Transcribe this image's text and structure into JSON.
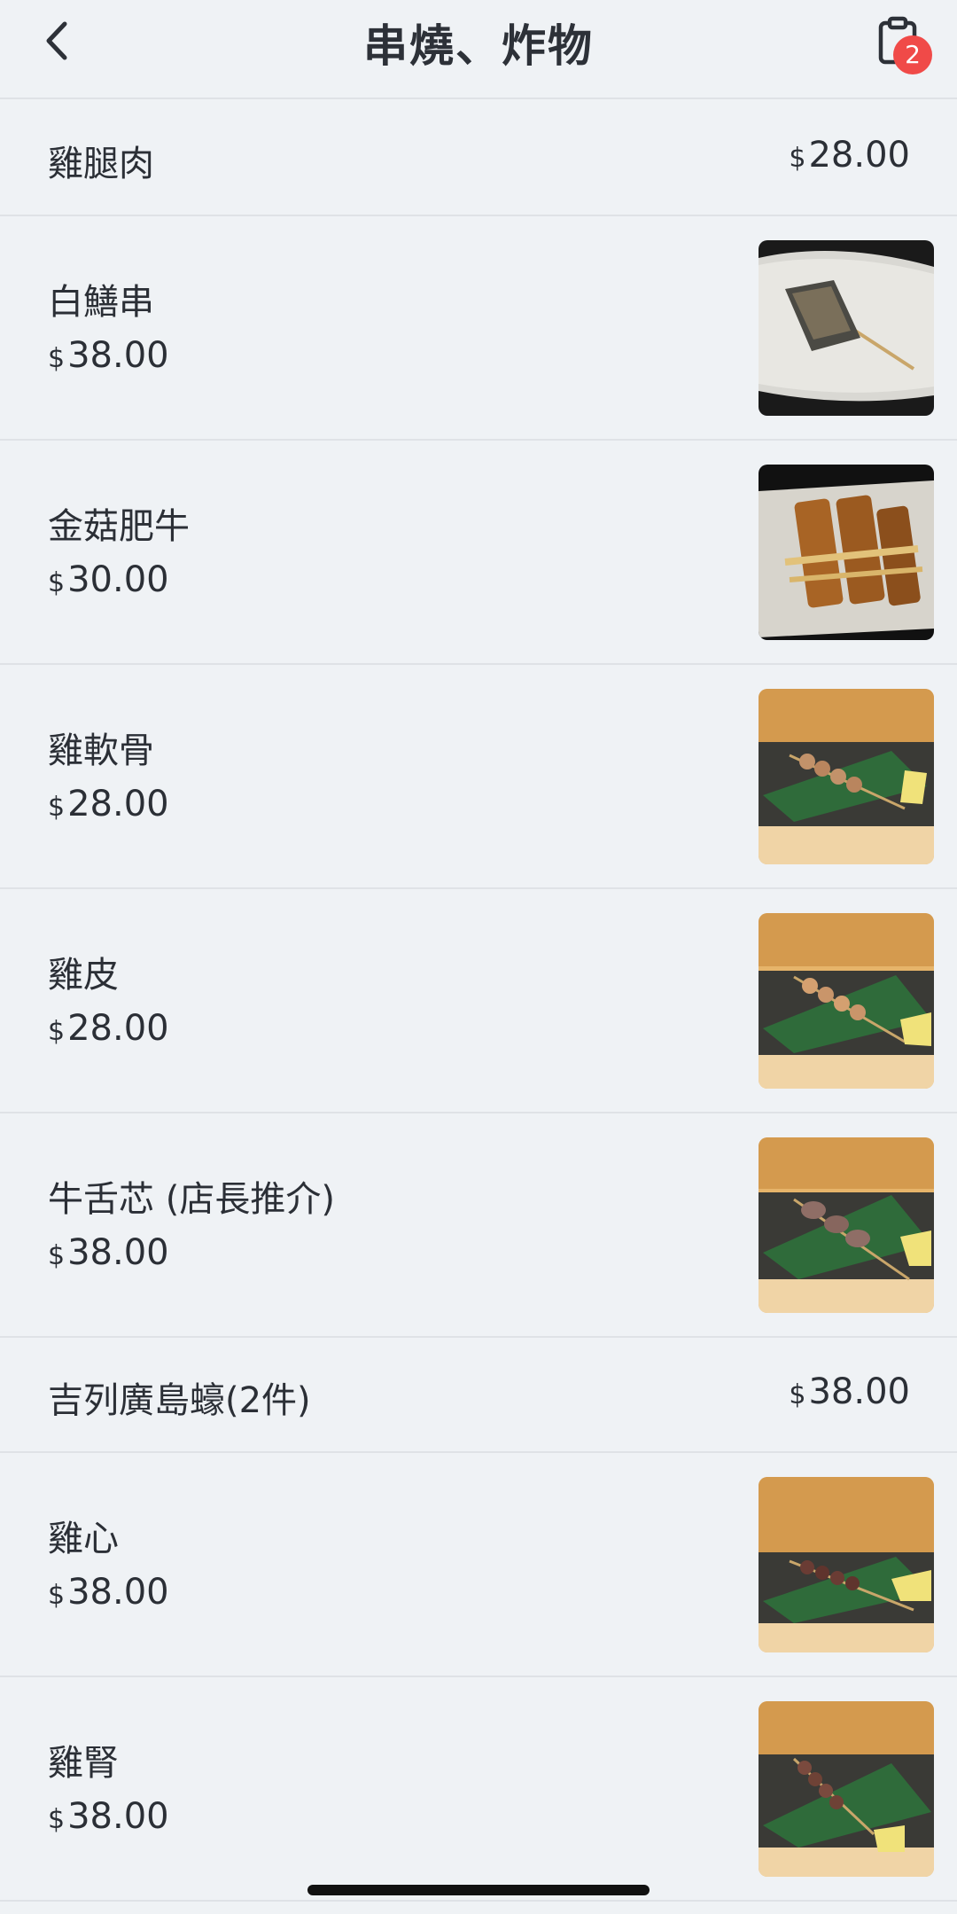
{
  "header": {
    "title": "串燒、炸物",
    "cart_count": "2"
  },
  "currency": "$",
  "items": [
    {
      "name": "雞腿肉",
      "price": "28.00",
      "has_image": false
    },
    {
      "name": "白鱔串",
      "price": "38.00",
      "has_image": true,
      "image": "eel-skewer-photo"
    },
    {
      "name": "金菇肥牛",
      "price": "30.00",
      "has_image": true,
      "image": "enoki-beef-photo"
    },
    {
      "name": "雞軟骨",
      "price": "28.00",
      "has_image": true,
      "image": "chicken-cartilage-photo"
    },
    {
      "name": "雞皮",
      "price": "28.00",
      "has_image": true,
      "image": "chicken-skin-photo"
    },
    {
      "name": "牛舌芯 (店長推介)",
      "price": "38.00",
      "has_image": true,
      "image": "beef-tongue-photo"
    },
    {
      "name": "吉列廣島蠔(2件)",
      "price": "38.00",
      "has_image": false
    },
    {
      "name": "雞心",
      "price": "38.00",
      "has_image": true,
      "image": "chicken-heart-photo"
    },
    {
      "name": "雞腎",
      "price": "38.00",
      "has_image": true,
      "image": "chicken-gizzard-photo"
    }
  ],
  "colors": {
    "background": "#eff2f5",
    "badge": "#f04a48",
    "divider": "#dfe2e6"
  }
}
